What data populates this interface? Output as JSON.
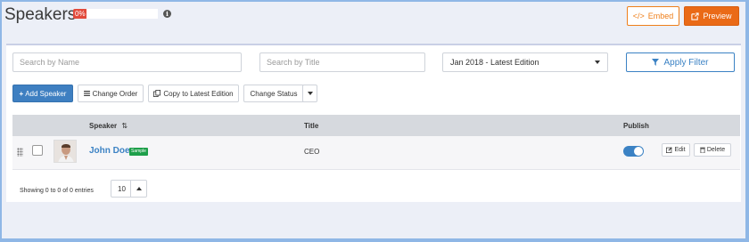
{
  "header": {
    "title": "Speakers",
    "progress_badge": "0%",
    "progress_percent": 0,
    "embed_label": "Embed",
    "preview_label": "Preview"
  },
  "filters": {
    "name_placeholder": "Search by Name",
    "title_placeholder": "Search by Title",
    "edition_selected": "Jan 2018 - Latest Edition",
    "apply_label": "Apply Filter"
  },
  "toolbar": {
    "add_label": "Add Speaker",
    "change_order_label": "Change Order",
    "copy_label": "Copy to Latest Edition",
    "change_status_label": "Change Status"
  },
  "table": {
    "columns": {
      "speaker": "Speaker",
      "title": "Title",
      "publish": "Publish"
    },
    "rows": [
      {
        "name": "John Doe",
        "badge": "Sample",
        "title": "CEO",
        "published": true,
        "edit_label": "Edit",
        "delete_label": "Delete"
      }
    ]
  },
  "footer": {
    "info": "Showing 0 to 0 of 0 entries",
    "page_size": "10"
  },
  "colors": {
    "accent": "#3b82c4",
    "orange": "#ea6a17",
    "danger": "#e24a3b",
    "success": "#1e9f4a"
  }
}
